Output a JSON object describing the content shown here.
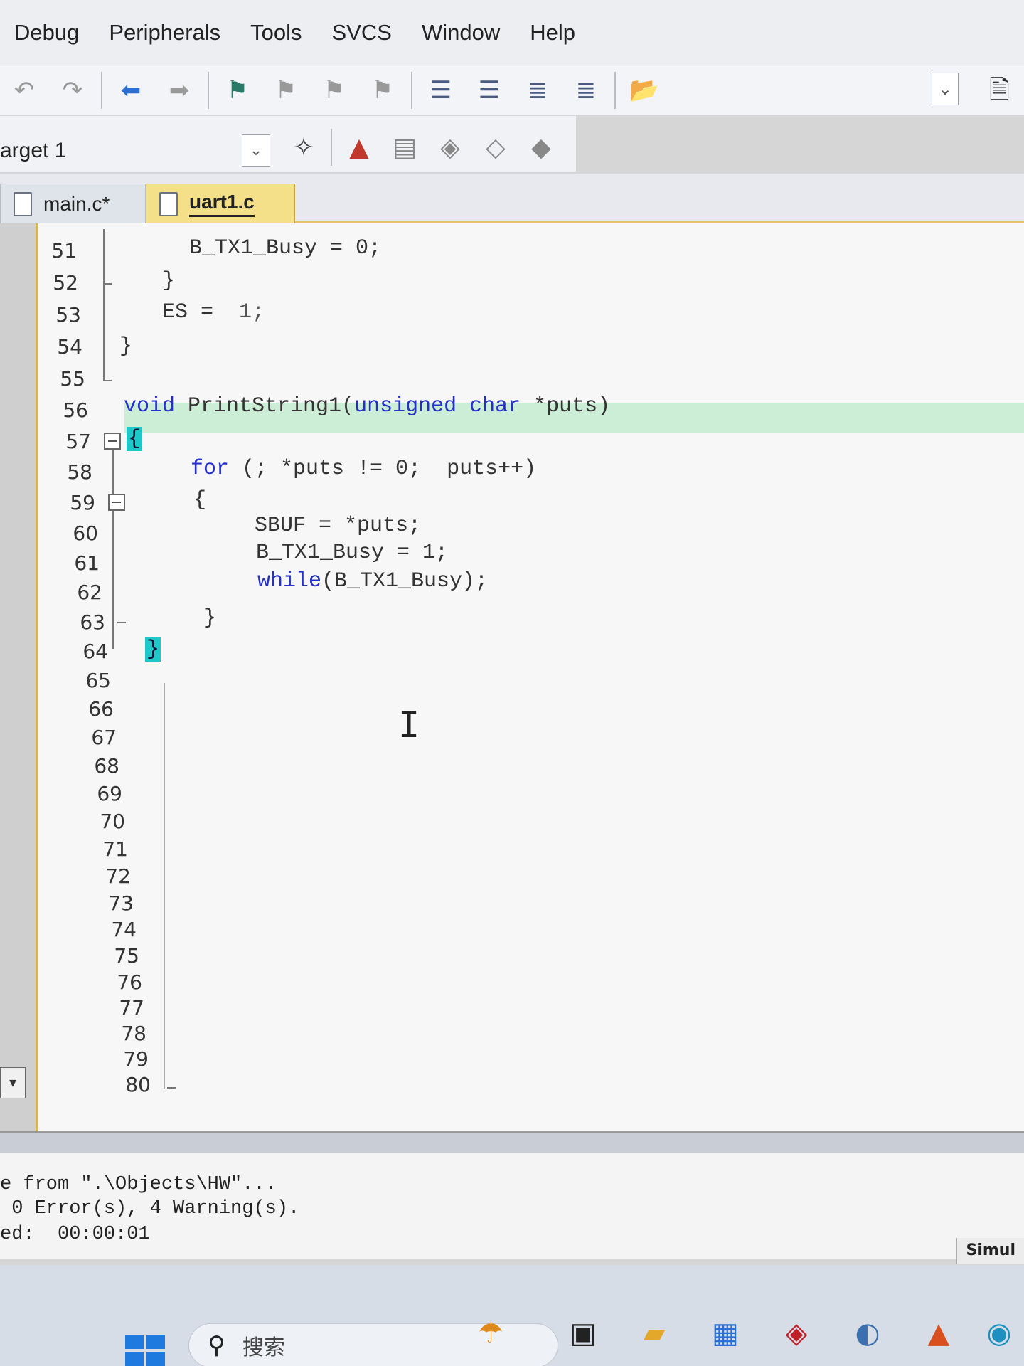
{
  "menu": [
    "Debug",
    "Peripherals",
    "Tools",
    "SVCS",
    "Window",
    "Help"
  ],
  "toolbar2": {
    "target": "arget 1"
  },
  "tabs": [
    {
      "label": "main.c*"
    },
    {
      "label": "uart1.c"
    }
  ],
  "editor": {
    "lines": [
      {
        "n": "51"
      },
      {
        "n": "52"
      },
      {
        "n": "53"
      },
      {
        "n": "54"
      },
      {
        "n": "55"
      },
      {
        "n": "56"
      },
      {
        "n": "57"
      },
      {
        "n": "58"
      },
      {
        "n": "59"
      },
      {
        "n": "60"
      },
      {
        "n": "61"
      },
      {
        "n": "62"
      },
      {
        "n": "63"
      },
      {
        "n": "64"
      },
      {
        "n": "65"
      },
      {
        "n": "66"
      },
      {
        "n": "67"
      },
      {
        "n": "68"
      },
      {
        "n": "69"
      },
      {
        "n": "70"
      },
      {
        "n": "71"
      },
      {
        "n": "72"
      },
      {
        "n": "73"
      },
      {
        "n": "74"
      },
      {
        "n": "75"
      },
      {
        "n": "76"
      },
      {
        "n": "77"
      },
      {
        "n": "78"
      },
      {
        "n": "79"
      },
      {
        "n": "80"
      }
    ],
    "code": {
      "l51": "B_TX1_Busy = 0;",
      "l52": "}",
      "l53_a": "ES = ",
      "l53_b": "1;",
      "l54": "}",
      "l56_kw1": "void",
      "l56_name": " PrintString1(",
      "l56_kw2": "unsigned",
      "l56_kw3": "char",
      "l56_rest": " *puts)",
      "l57": "{",
      "l58_kw": "for",
      "l58_rest": " (; *puts != 0;  puts++)",
      "l59": "{",
      "l60": "SBUF = *puts;",
      "l61": "B_TX1_Busy = 1;",
      "l62_kw": "while",
      "l62_rest": "(B_TX1_Busy);",
      "l63": "}",
      "l64": "}"
    }
  },
  "output": {
    "line1": "e from \".\\Objects\\HW\"...",
    "line2": " 0 Error(s), 4 Warning(s).",
    "line3": "ed:  00:00:01"
  },
  "status": {
    "mode": "Simul"
  },
  "taskbar": {
    "search_label": "搜索"
  },
  "colors": {
    "keyword": "#2430c8",
    "highlight": "#cdeed6",
    "active_tab": "#f5e08a",
    "brace_match": "#1ec8c8"
  }
}
